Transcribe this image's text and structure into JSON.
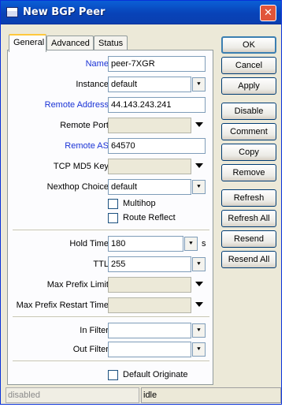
{
  "window": {
    "title": "New BGP Peer",
    "close": "✕"
  },
  "tabs": [
    "General",
    "Advanced",
    "Status"
  ],
  "fields": {
    "name": {
      "label": "Name:",
      "value": "peer-7XGR"
    },
    "instance": {
      "label": "Instance:",
      "value": "default"
    },
    "remote_address": {
      "label": "Remote Address:",
      "value": "44.143.243.241"
    },
    "remote_port": {
      "label": "Remote Port:",
      "value": ""
    },
    "remote_as": {
      "label": "Remote AS:",
      "value": "64570"
    },
    "tcp_md5_key": {
      "label": "TCP MD5 Key:",
      "value": ""
    },
    "nexthop_choice": {
      "label": "Nexthop Choice:",
      "value": "default"
    },
    "multihop": {
      "label": "Multihop",
      "checked": false
    },
    "route_reflect": {
      "label": "Route Reflect",
      "checked": false
    },
    "hold_time": {
      "label": "Hold Time:",
      "value": "180",
      "unit": "s"
    },
    "ttl": {
      "label": "TTL:",
      "value": "255"
    },
    "max_prefix_limit": {
      "label": "Max Prefix Limit:",
      "value": ""
    },
    "max_prefix_restart_time": {
      "label": "Max Prefix Restart Time:",
      "value": ""
    },
    "in_filter": {
      "label": "In Filter:",
      "value": ""
    },
    "out_filter": {
      "label": "Out Filter:",
      "value": ""
    },
    "default_originate": {
      "label": "Default Originate",
      "checked": false
    }
  },
  "buttons": [
    "OK",
    "Cancel",
    "Apply",
    "Disable",
    "Comment",
    "Copy",
    "Remove",
    "Refresh",
    "Refresh All",
    "Resend",
    "Resend All"
  ],
  "status": {
    "left": "disabled",
    "right": "idle"
  },
  "dropdown_glyph": "⯆"
}
